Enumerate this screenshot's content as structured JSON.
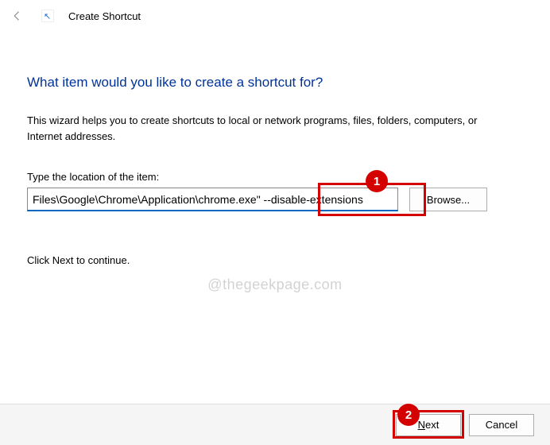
{
  "header": {
    "title": "Create Shortcut"
  },
  "heading": "What item would you like to create a shortcut for?",
  "description": "This wizard helps you to create shortcuts to local or network programs, files, folders, computers, or Internet addresses.",
  "field_label": "Type the location of the item:",
  "path_value": "Files\\Google\\Chrome\\Application\\chrome.exe\" --disable-extensions",
  "browse_label": "Browse...",
  "continue_text": "Click Next to continue.",
  "footer": {
    "next_label": "Next",
    "cancel_label": "Cancel"
  },
  "annotations": {
    "badge1": "1",
    "badge2": "2"
  },
  "watermark": "@thegeekpage.com"
}
